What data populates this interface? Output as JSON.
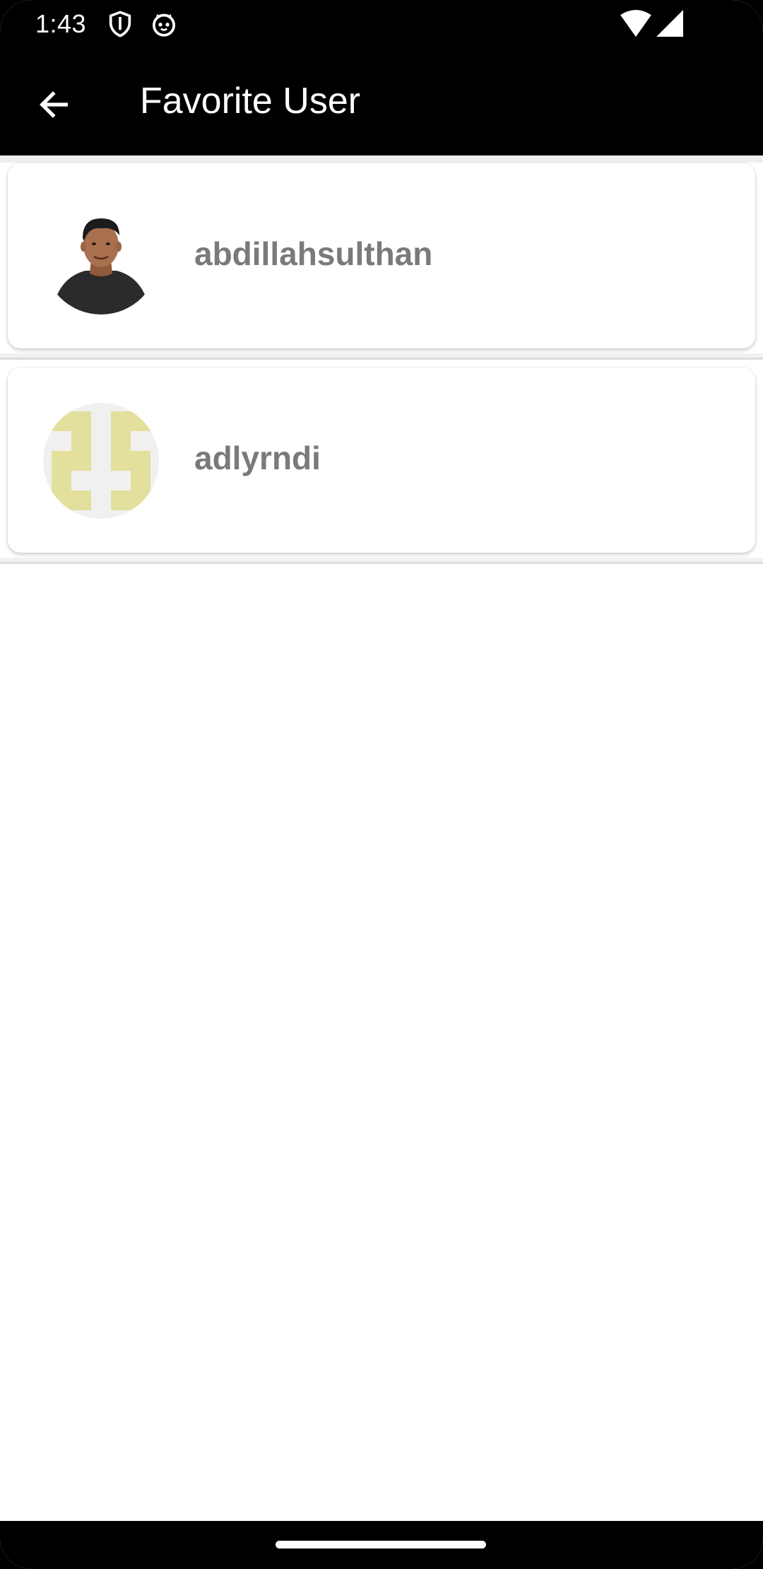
{
  "status_bar": {
    "time": "1:43",
    "icons": [
      "shield-icon",
      "cat-face-icon",
      "wifi-icon",
      "cellular-signal-icon"
    ]
  },
  "app_bar": {
    "title": "Favorite User",
    "back_icon": "arrow-left-icon"
  },
  "favorites": [
    {
      "username": "abdillahsulthan",
      "avatar": "photo"
    },
    {
      "username": "adlyrndi",
      "avatar": "identicon"
    }
  ],
  "colors": {
    "bar_background": "#000000",
    "username_text": "#7a7a7a",
    "identicon_fill": "#e2e09c",
    "identicon_background": "#f0f0f0"
  }
}
